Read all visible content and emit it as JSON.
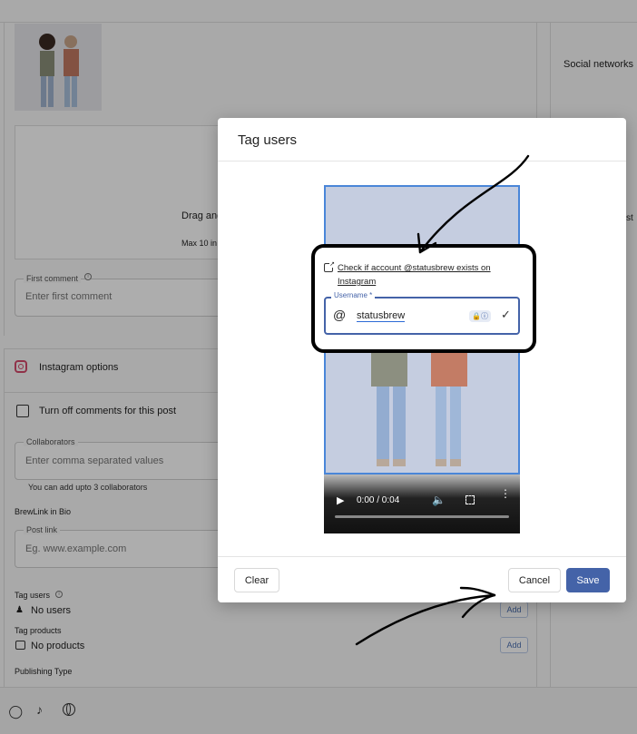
{
  "sidebar_right": {
    "social_networks": "Social networks",
    "partial_text": "st"
  },
  "dropzone": {
    "drag_text": "Drag and",
    "max_text": "Max 10 in"
  },
  "first_comment": {
    "label": "First comment",
    "placeholder": "Enter first comment"
  },
  "instagram_options": {
    "title": "Instagram options"
  },
  "turn_off_comments": "Turn off comments for this post",
  "collaborators": {
    "label": "Collaborators",
    "placeholder": "Enter comma separated values",
    "hint": "You can add upto 3 collaborators"
  },
  "brewlink": {
    "title": "BrewLink in Bio",
    "label": "Post link",
    "placeholder": "Eg. www.example.com"
  },
  "tag_users_section": {
    "title": "Tag users",
    "value": "No users",
    "add": "Add"
  },
  "tag_products_section": {
    "title": "Tag products",
    "value": "No products",
    "add": "Add"
  },
  "publishing_type": {
    "title": "Publishing Type"
  },
  "modal": {
    "title": "Tag users",
    "check_link_line1": "Check if account @statusbrew exists on",
    "check_link_line2": "Instagram",
    "username_label": "Username *",
    "username_value": "statusbrew",
    "video_time": "0:00 / 0:04",
    "progress": 0,
    "clear": "Clear",
    "cancel": "Cancel",
    "save": "Save"
  },
  "colors": {
    "accent": "#4463a8",
    "video_border": "#4a86d8",
    "link": "#4a6fb0"
  }
}
